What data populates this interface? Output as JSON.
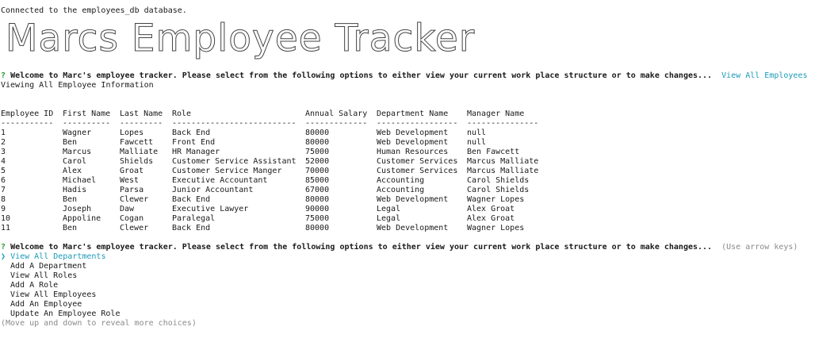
{
  "connection_message": "Connected to the employees_db database.",
  "banner_title": "Marcs Employee Tracker",
  "prompt": {
    "mark": "?",
    "question": "Welcome to Marc's employee tracker. Please select from the following options to either view your current work place structure or to make changes...",
    "first_answer": "View All Employees",
    "second_hint": "(Use arrow keys)"
  },
  "viewing_message": "Viewing All Employee Information",
  "table": {
    "headers": [
      "Employee ID",
      "First Name",
      "Last Name",
      "Role",
      "Annual Salary",
      "Department Name",
      "Manager Name"
    ],
    "underlines": [
      "-----------",
      "----------",
      "---------",
      "--------------------------",
      "-------------",
      "-----------------",
      "---------------"
    ],
    "rows": [
      [
        "1",
        "Wagner",
        "Lopes",
        "Back End",
        "80000",
        "Web Development",
        "null"
      ],
      [
        "2",
        "Ben",
        "Fawcett",
        "Front End",
        "80000",
        "Web Development",
        "null"
      ],
      [
        "3",
        "Marcus",
        "Malliate",
        "HR Manager",
        "75000",
        "Human Resources",
        "Ben Fawcett"
      ],
      [
        "4",
        "Carol",
        "Shields",
        "Customer Service Assistant",
        "52000",
        "Customer Services",
        "Marcus Malliate"
      ],
      [
        "5",
        "Alex",
        "Groat",
        "Customer Service Manger",
        "70000",
        "Customer Services",
        "Marcus Malliate"
      ],
      [
        "6",
        "Michael",
        "West",
        "Executive Accountant",
        "85000",
        "Accounting",
        "Carol Shields"
      ],
      [
        "7",
        "Hadis",
        "Parsa",
        "Junior Accountant",
        "67000",
        "Accounting",
        "Carol Shields"
      ],
      [
        "8",
        "Ben",
        "Clewer",
        "Back End",
        "80000",
        "Web Development",
        "Wagner Lopes"
      ],
      [
        "9",
        "Joseph",
        "Daw",
        "Executive Lawyer",
        "90000",
        "Legal",
        "Alex Groat"
      ],
      [
        "10",
        "Appoline",
        "Cogan",
        "Paralegal",
        "75000",
        "Legal",
        "Alex Groat"
      ],
      [
        "11",
        "Ben",
        "Clewer",
        "Back End",
        "80000",
        "Web Development",
        "Wagner Lopes"
      ]
    ]
  },
  "menu": {
    "pointer": "❯",
    "selected": "View All Departments",
    "items": [
      "Add A Department",
      "View All Roles",
      "Add A Role",
      "View All Employees",
      "Add An Employee",
      "Update An Employee Role"
    ],
    "footer_hint": "(Move up and down to reveal more choices)"
  }
}
